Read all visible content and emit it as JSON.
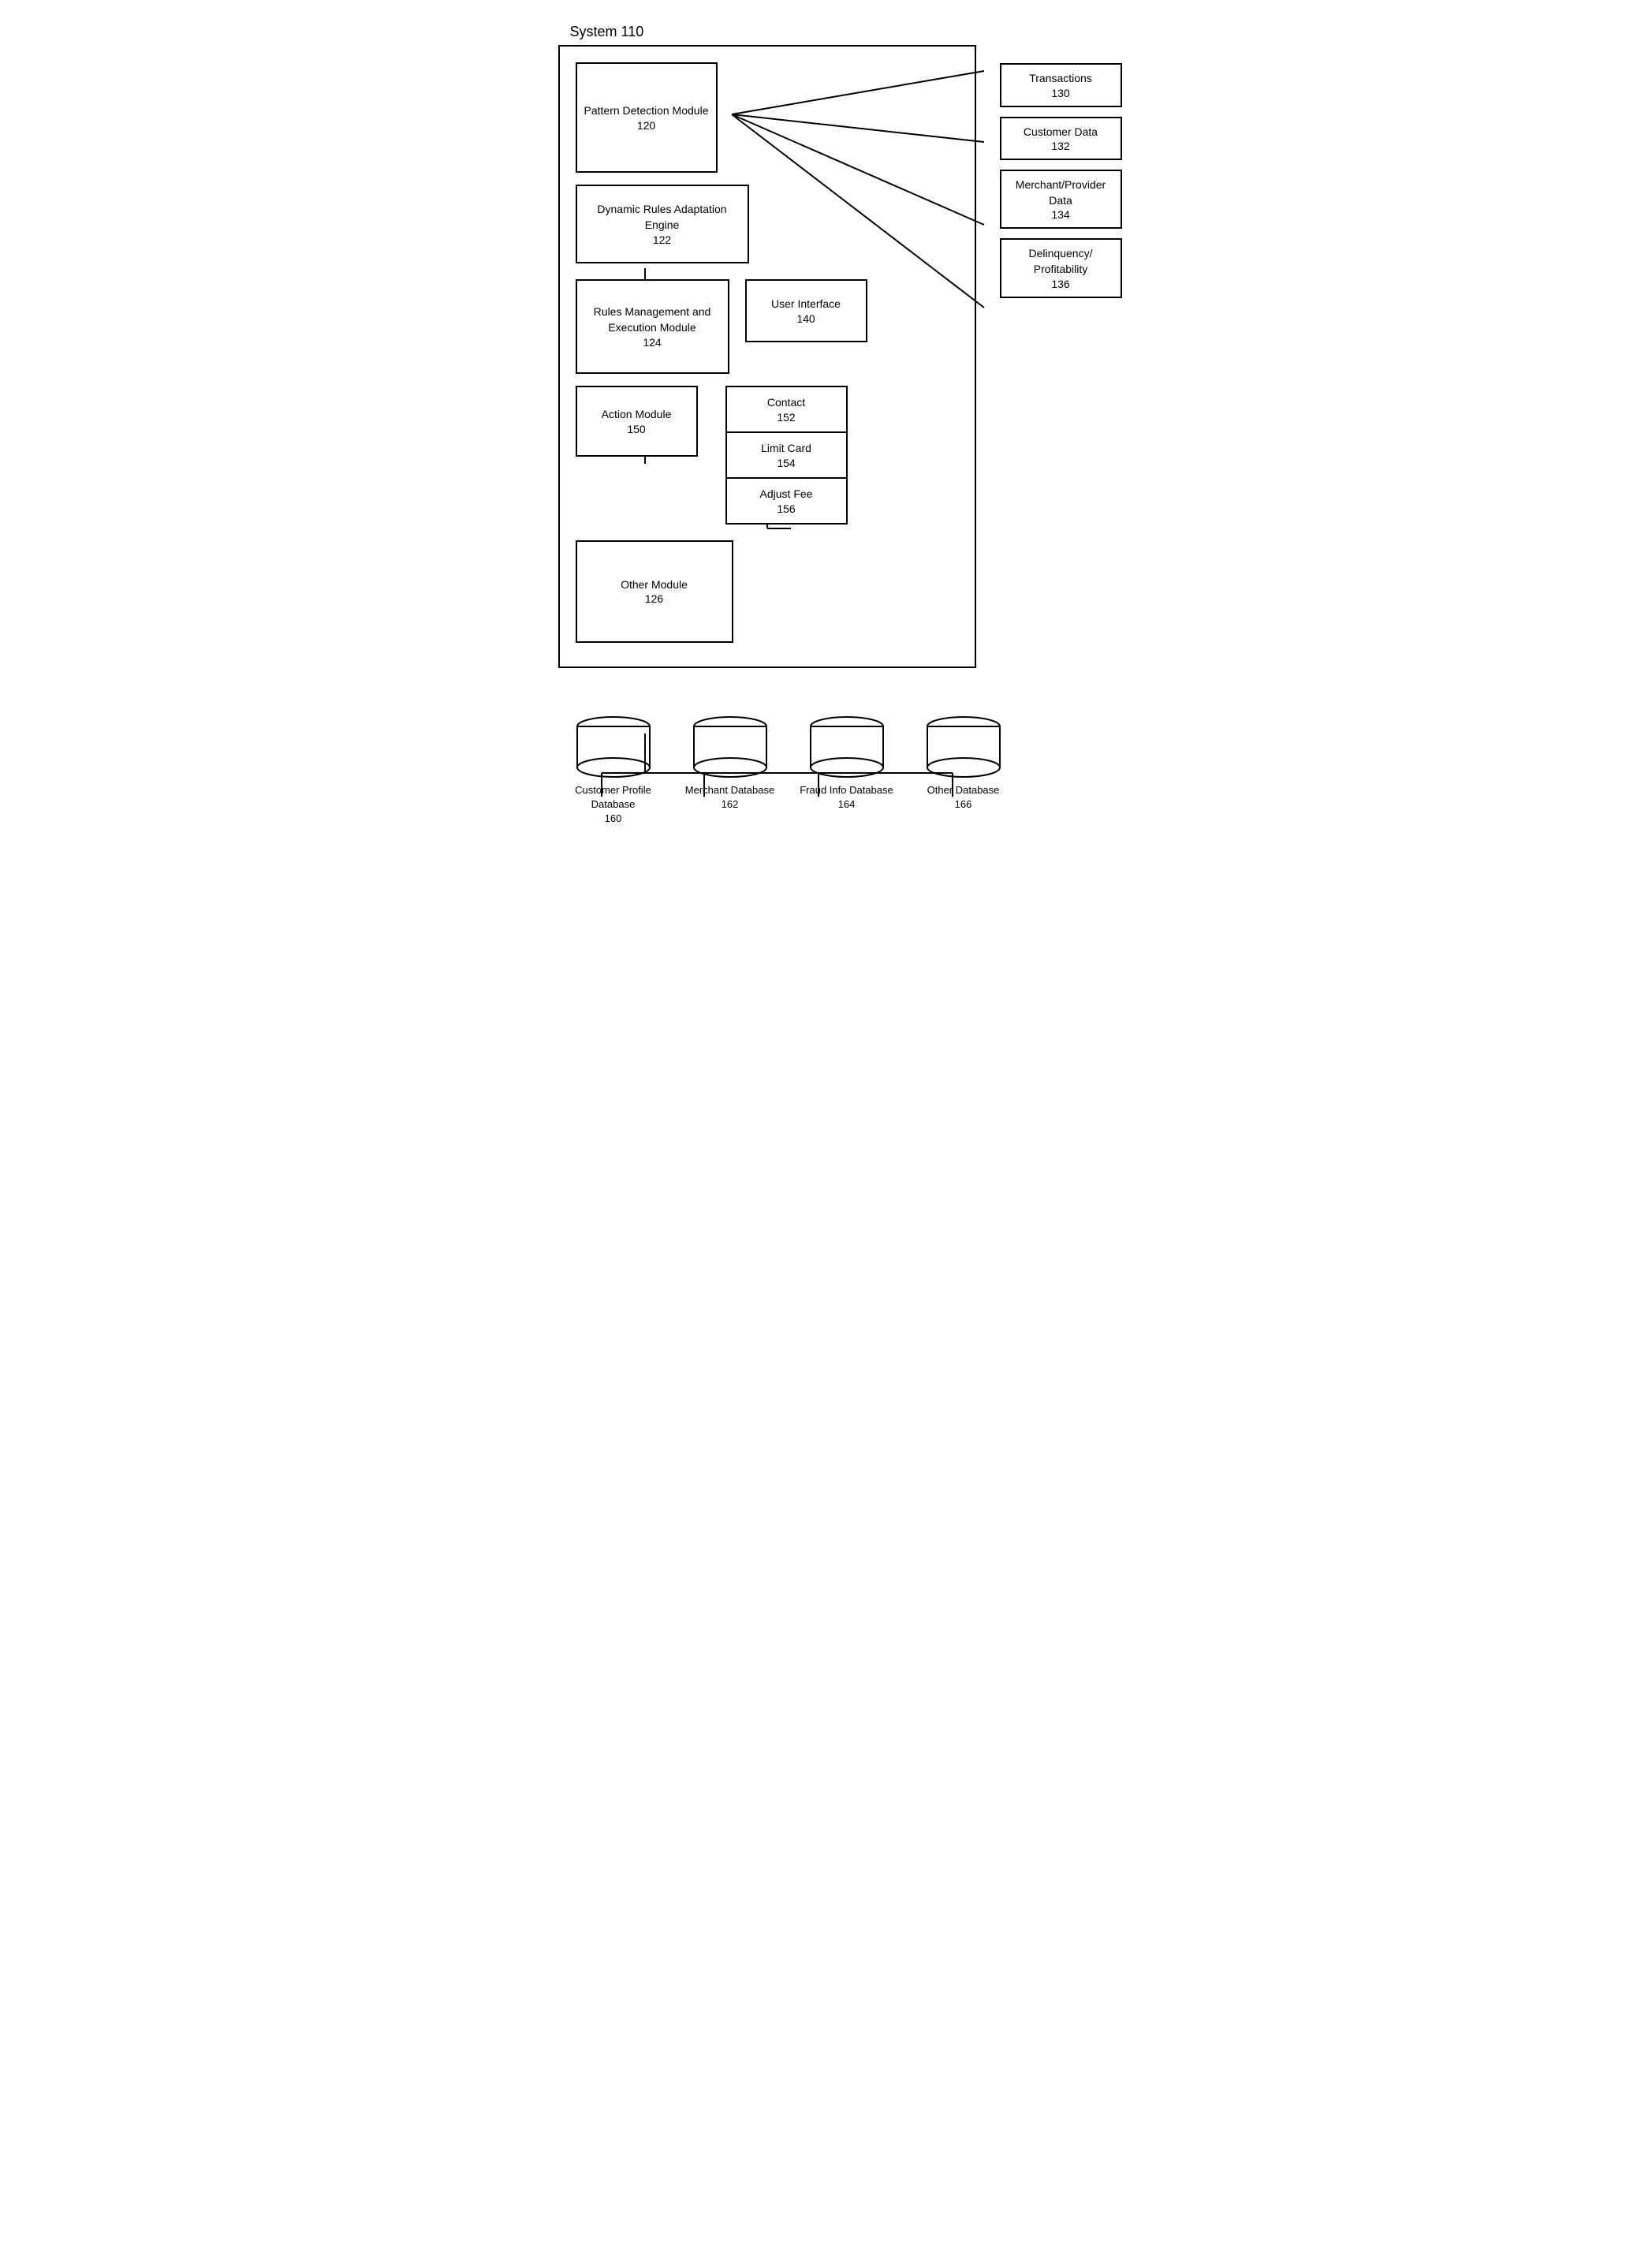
{
  "diagram": {
    "system_label": "System 110",
    "modules": {
      "pattern_detection": {
        "name": "Pattern Detection Module",
        "number": "120"
      },
      "dynamic_rules": {
        "name": "Dynamic Rules Adaptation Engine",
        "number": "122"
      },
      "rules_management": {
        "name": "Rules Management and Execution Module",
        "number": "124"
      },
      "user_interface": {
        "name": "User Interface",
        "number": "140"
      },
      "action_module": {
        "name": "Action Module",
        "number": "150"
      },
      "contact": {
        "name": "Contact",
        "number": "152"
      },
      "limit_card": {
        "name": "Limit Card",
        "number": "154"
      },
      "adjust_fee": {
        "name": "Adjust Fee",
        "number": "156"
      },
      "other_module": {
        "name": "Other Module",
        "number": "126"
      }
    },
    "data_sources": {
      "transactions": {
        "name": "Transactions",
        "number": "130"
      },
      "customer_data": {
        "name": "Customer Data",
        "number": "132"
      },
      "merchant_provider": {
        "name": "Merchant/Provider Data",
        "number": "134"
      },
      "delinquency": {
        "name": "Delinquency/ Profitability",
        "number": "136"
      }
    },
    "databases": {
      "customer_profile": {
        "name": "Customer Profile Database",
        "number": "160"
      },
      "merchant": {
        "name": "Merchant Database",
        "number": "162"
      },
      "fraud_info": {
        "name": "Fraud Info Database",
        "number": "164"
      },
      "other": {
        "name": "Other Database",
        "number": "166"
      }
    }
  }
}
